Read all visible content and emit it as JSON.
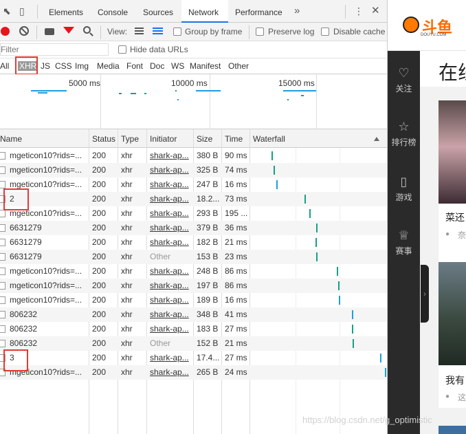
{
  "tabs": [
    "Elements",
    "Console",
    "Sources",
    "Network",
    "Performance"
  ],
  "active_tab": "Network",
  "toolbar": {
    "view_label": "View:",
    "group_by_frame": "Group by frame",
    "preserve_log": "Preserve log",
    "disable_cache": "Disable cache"
  },
  "filter": {
    "placeholder": "Filter",
    "hide_data_urls": "Hide data URLs"
  },
  "types": [
    "All",
    "XHR",
    "JS",
    "CSS",
    "Img",
    "Media",
    "Font",
    "Doc",
    "WS",
    "Manifest",
    "Other"
  ],
  "active_type": "XHR",
  "overview_ticks": [
    "5000 ms",
    "10000 ms",
    "15000 ms"
  ],
  "columns": [
    "Name",
    "Status",
    "Type",
    "Initiator",
    "Size",
    "Time",
    "Waterfall"
  ],
  "rows": [
    {
      "name": "mgeticon10?rids=...",
      "status": "200",
      "type": "xhr",
      "initiator": "shark-ap...",
      "size": "380 B",
      "time": "90 ms"
    },
    {
      "name": "mgeticon10?rids=...",
      "status": "200",
      "type": "xhr",
      "initiator": "shark-ap...",
      "size": "325 B",
      "time": "74 ms"
    },
    {
      "name": "mgeticon10?rids=...",
      "status": "200",
      "type": "xhr",
      "initiator": "shark-ap...",
      "size": "247 B",
      "time": "16 ms"
    },
    {
      "name": "2",
      "status": "200",
      "type": "xhr",
      "initiator": "shark-ap...",
      "size": "18.2...",
      "time": "73 ms"
    },
    {
      "name": "mgeticon10?rids=...",
      "status": "200",
      "type": "xhr",
      "initiator": "shark-ap...",
      "size": "293 B",
      "time": "195 ..."
    },
    {
      "name": "6631279",
      "status": "200",
      "type": "xhr",
      "initiator": "shark-ap...",
      "size": "379 B",
      "time": "36 ms"
    },
    {
      "name": "6631279",
      "status": "200",
      "type": "xhr",
      "initiator": "shark-ap...",
      "size": "182 B",
      "time": "21 ms"
    },
    {
      "name": "6631279",
      "status": "200",
      "type": "xhr",
      "initiator": "Other",
      "size": "153 B",
      "time": "23 ms"
    },
    {
      "name": "mgeticon10?rids=...",
      "status": "200",
      "type": "xhr",
      "initiator": "shark-ap...",
      "size": "248 B",
      "time": "86 ms"
    },
    {
      "name": "mgeticon10?rids=...",
      "status": "200",
      "type": "xhr",
      "initiator": "shark-ap...",
      "size": "197 B",
      "time": "86 ms"
    },
    {
      "name": "mgeticon10?rids=...",
      "status": "200",
      "type": "xhr",
      "initiator": "shark-ap...",
      "size": "189 B",
      "time": "16 ms"
    },
    {
      "name": "806232",
      "status": "200",
      "type": "xhr",
      "initiator": "shark-ap...",
      "size": "348 B",
      "time": "41 ms"
    },
    {
      "name": "806232",
      "status": "200",
      "type": "xhr",
      "initiator": "shark-ap...",
      "size": "183 B",
      "time": "27 ms"
    },
    {
      "name": "806232",
      "status": "200",
      "type": "xhr",
      "initiator": "Other",
      "size": "152 B",
      "time": "21 ms"
    },
    {
      "name": "3",
      "status": "200",
      "type": "xhr",
      "initiator": "shark-ap...",
      "size": "17.4...",
      "time": "27 ms"
    },
    {
      "name": "mgeticon10?rids=...",
      "status": "200",
      "type": "xhr",
      "initiator": "shark-ap...",
      "size": "265 B",
      "time": "24 ms"
    }
  ],
  "site": {
    "logo_text": "斗鱼",
    "logo_sub": "DOUYU.COM",
    "heading": "在线",
    "nav": [
      "关注",
      "排行榜",
      "游戏",
      "赛事"
    ],
    "card1_title": "菜还",
    "card1_meta": "奈",
    "card2_title": "我有",
    "card2_meta": "这"
  },
  "watermark": "https://blog.csdn.net/g_optimistic"
}
